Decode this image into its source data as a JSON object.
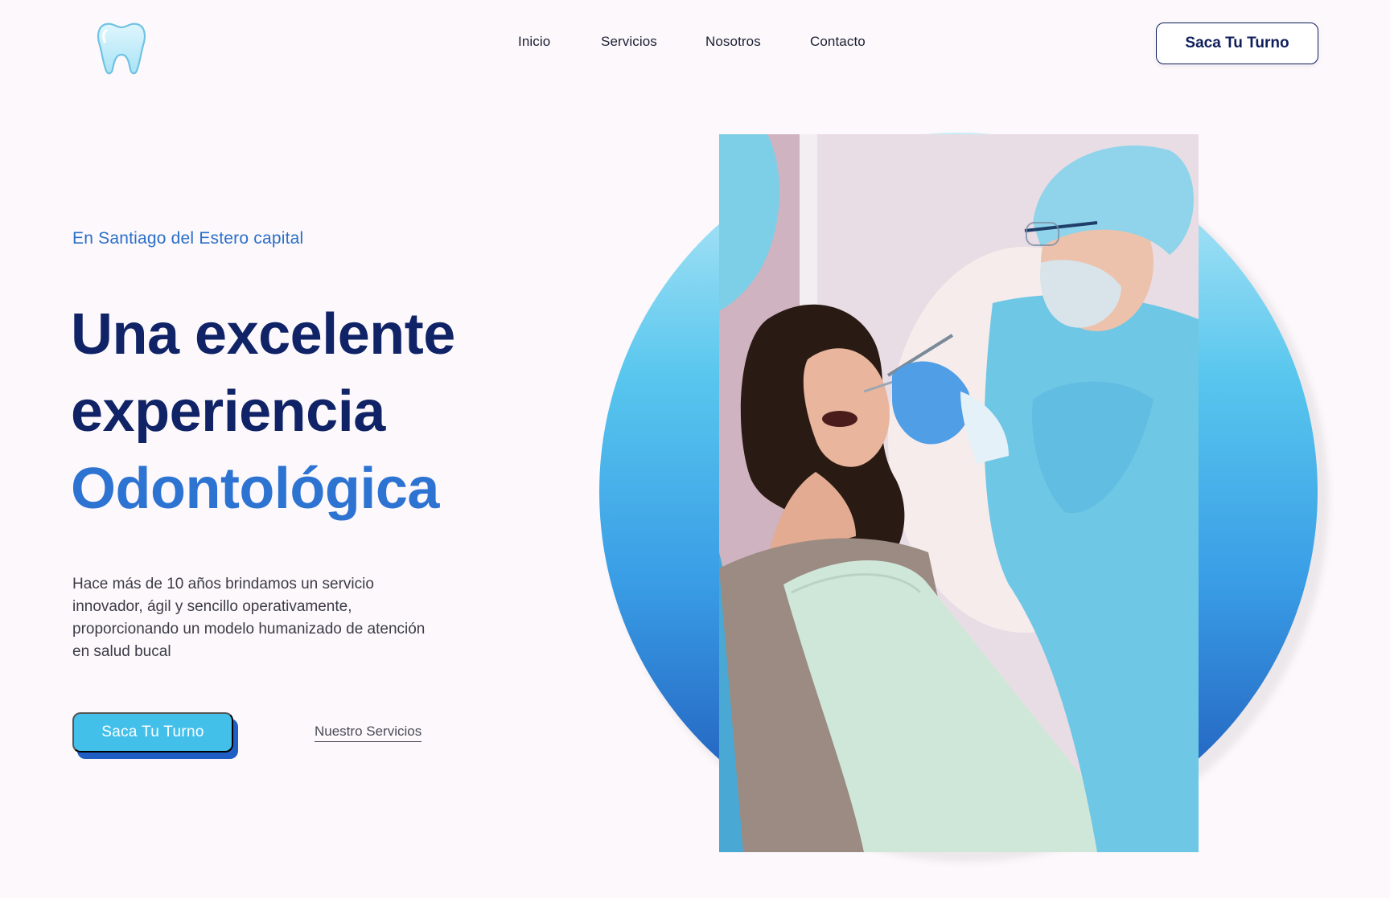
{
  "header": {
    "logo_icon": "tooth-icon",
    "nav": [
      "Inicio",
      "Servicios",
      "Nosotros",
      "Contacto"
    ],
    "cta_label": "Saca Tu Turno"
  },
  "hero": {
    "eyebrow": "En Santiago del Estero capital",
    "headline_line1": "Una excelente",
    "headline_line2": "experiencia",
    "headline_line3": "Odontológica",
    "description": "Hace más de 10 años brindamos un servicio innovador, ágil y sencillo operativamente, proporcionando un modelo humanizado de atención en salud bucal",
    "primary_cta": "Saca Tu Turno",
    "secondary_link": "Nuestro Servicios"
  },
  "colors": {
    "navy": "#0f2366",
    "accent_blue": "#2c73d2",
    "cyan": "#43c0ea",
    "background": "#fcf8fb"
  }
}
